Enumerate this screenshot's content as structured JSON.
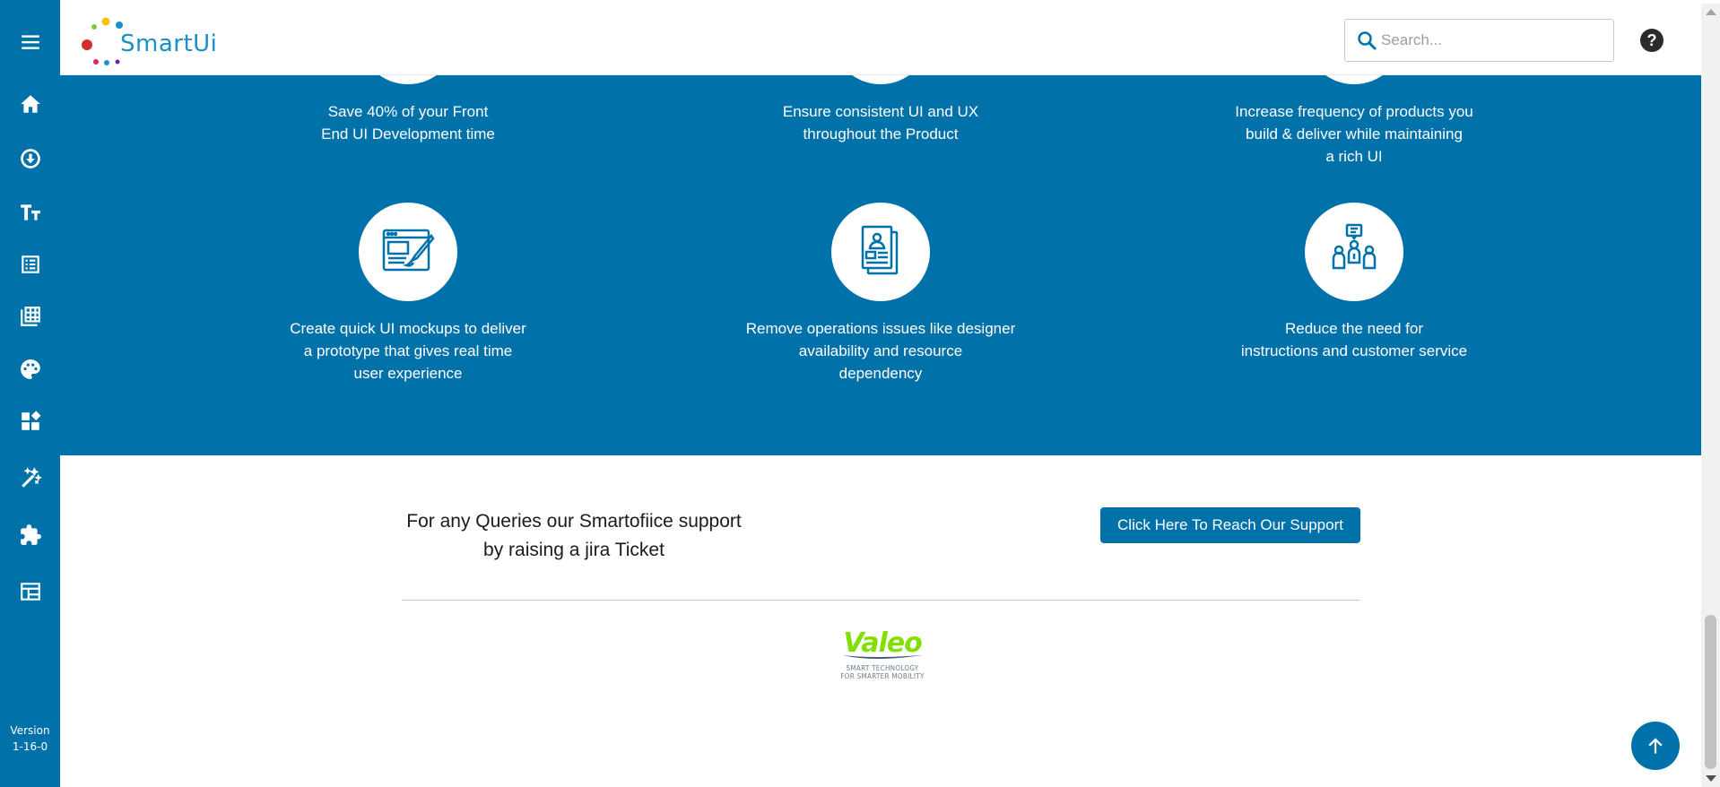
{
  "app": {
    "logo_text": "SmartUi",
    "version_label": "Version",
    "version_value": "1-16-0"
  },
  "header": {
    "search_placeholder": "Search...",
    "help_label": "?"
  },
  "sidebar": {
    "items": [
      {
        "icon": "menu-icon"
      },
      {
        "icon": "home-icon"
      },
      {
        "icon": "download-circle-icon"
      },
      {
        "icon": "typography-icon"
      },
      {
        "icon": "list-icon"
      },
      {
        "icon": "table-grid-icon"
      },
      {
        "icon": "palette-icon"
      },
      {
        "icon": "dashboard-icon"
      },
      {
        "icon": "magic-wand-icon"
      },
      {
        "icon": "puzzle-icon"
      },
      {
        "icon": "layout-icon"
      }
    ]
  },
  "features": [
    {
      "lines": [
        "Save 40% of your Front",
        "End UI Development time"
      ]
    },
    {
      "lines": [
        "Ensure consistent UI and UX",
        "throughout the Product"
      ]
    },
    {
      "lines": [
        "Increase frequency of products you",
        "build & deliver while maintaining",
        "a rich UI"
      ]
    },
    {
      "lines": [
        "Create quick UI mockups to deliver",
        "a prototype that gives real time",
        "user experience"
      ],
      "icon": "mockup-design-icon"
    },
    {
      "lines": [
        "Remove operations issues like designer",
        "availability and resource",
        "dependency"
      ],
      "icon": "profile-document-icon"
    },
    {
      "lines": [
        "Reduce the need for",
        "instructions and customer service"
      ],
      "icon": "customer-service-icon"
    }
  ],
  "support": {
    "line1": "For any Queries our Smartofiice support",
    "line2": "by raising a jira Ticket",
    "button_label": "Click Here To Reach Our Support"
  },
  "footer": {
    "brand": "Valeo",
    "tagline1": "SMART TECHNOLOGY",
    "tagline2": "FOR SMARTER MOBILITY"
  },
  "colors": {
    "primary": "#0071a9",
    "brand_green": "#82e000"
  }
}
